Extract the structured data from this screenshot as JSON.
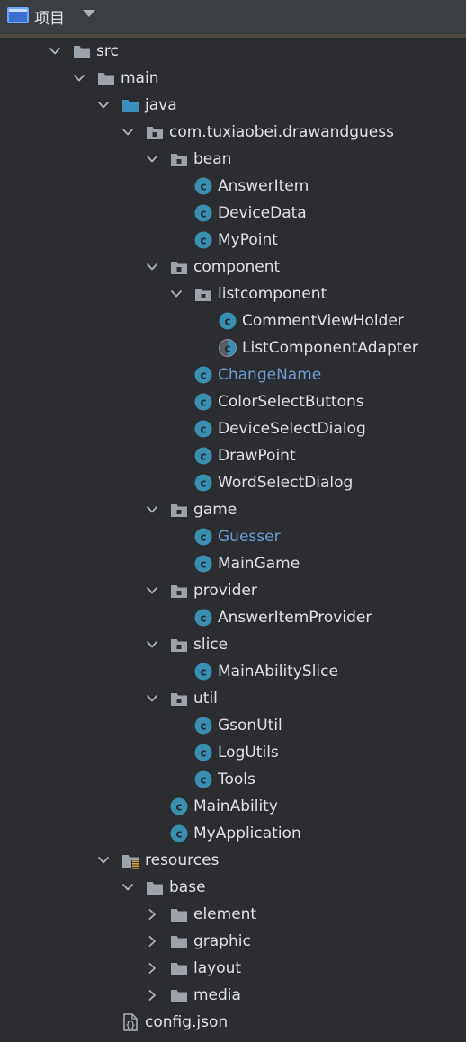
{
  "header": {
    "title": "项目"
  },
  "colors": {
    "background": "#2b2d30",
    "text": "#dfe1e5",
    "modified_text": "#6e9bd1",
    "folder": "#9da3ab",
    "source_folder": "#3d8fbd",
    "class_icon": "#3a8fb0"
  },
  "tree": [
    {
      "label": "src",
      "depth": 0,
      "expanded": true,
      "icon": "folder-icon"
    },
    {
      "label": "main",
      "depth": 1,
      "expanded": true,
      "icon": "folder-icon"
    },
    {
      "label": "java",
      "depth": 2,
      "expanded": true,
      "icon": "source-folder-icon"
    },
    {
      "label": "com.tuxiaobei.drawandguess",
      "depth": 3,
      "expanded": true,
      "icon": "package-icon"
    },
    {
      "label": "bean",
      "depth": 4,
      "expanded": true,
      "icon": "package-icon"
    },
    {
      "label": "AnswerItem",
      "depth": 5,
      "icon": "class-icon"
    },
    {
      "label": "DeviceData",
      "depth": 5,
      "icon": "class-icon"
    },
    {
      "label": "MyPoint",
      "depth": 5,
      "icon": "class-icon"
    },
    {
      "label": "component",
      "depth": 4,
      "expanded": true,
      "icon": "package-icon"
    },
    {
      "label": "listcomponent",
      "depth": 5,
      "expanded": true,
      "icon": "package-icon"
    },
    {
      "label": "CommentViewHolder",
      "depth": 6,
      "icon": "class-icon"
    },
    {
      "label": "ListComponentAdapter",
      "depth": 6,
      "icon": "abstract-class-icon"
    },
    {
      "label": "ChangeName",
      "depth": 5,
      "icon": "class-icon",
      "modified": true
    },
    {
      "label": "ColorSelectButtons",
      "depth": 5,
      "icon": "class-icon"
    },
    {
      "label": "DeviceSelectDialog",
      "depth": 5,
      "icon": "class-icon"
    },
    {
      "label": "DrawPoint",
      "depth": 5,
      "icon": "class-icon"
    },
    {
      "label": "WordSelectDialog",
      "depth": 5,
      "icon": "class-icon"
    },
    {
      "label": "game",
      "depth": 4,
      "expanded": true,
      "icon": "package-icon"
    },
    {
      "label": "Guesser",
      "depth": 5,
      "icon": "class-icon",
      "modified": true
    },
    {
      "label": "MainGame",
      "depth": 5,
      "icon": "class-icon"
    },
    {
      "label": "provider",
      "depth": 4,
      "expanded": true,
      "icon": "package-icon"
    },
    {
      "label": "AnswerItemProvider",
      "depth": 5,
      "icon": "class-icon"
    },
    {
      "label": "slice",
      "depth": 4,
      "expanded": true,
      "icon": "package-icon"
    },
    {
      "label": "MainAbilitySlice",
      "depth": 5,
      "icon": "class-icon"
    },
    {
      "label": "util",
      "depth": 4,
      "expanded": true,
      "icon": "package-icon"
    },
    {
      "label": "GsonUtil",
      "depth": 5,
      "icon": "class-icon"
    },
    {
      "label": "LogUtils",
      "depth": 5,
      "icon": "class-icon"
    },
    {
      "label": "Tools",
      "depth": 5,
      "icon": "class-icon"
    },
    {
      "label": "MainAbility",
      "depth": 4,
      "icon": "class-icon"
    },
    {
      "label": "MyApplication",
      "depth": 4,
      "icon": "class-icon"
    },
    {
      "label": "resources",
      "depth": 2,
      "expanded": true,
      "icon": "resources-folder-icon"
    },
    {
      "label": "base",
      "depth": 3,
      "expanded": true,
      "icon": "folder-icon"
    },
    {
      "label": "element",
      "depth": 4,
      "expanded": false,
      "icon": "folder-icon"
    },
    {
      "label": "graphic",
      "depth": 4,
      "expanded": false,
      "icon": "folder-icon"
    },
    {
      "label": "layout",
      "depth": 4,
      "expanded": false,
      "icon": "folder-icon"
    },
    {
      "label": "media",
      "depth": 4,
      "expanded": false,
      "icon": "folder-icon"
    },
    {
      "label": "config.json",
      "depth": 2,
      "icon": "json-file-icon"
    }
  ]
}
